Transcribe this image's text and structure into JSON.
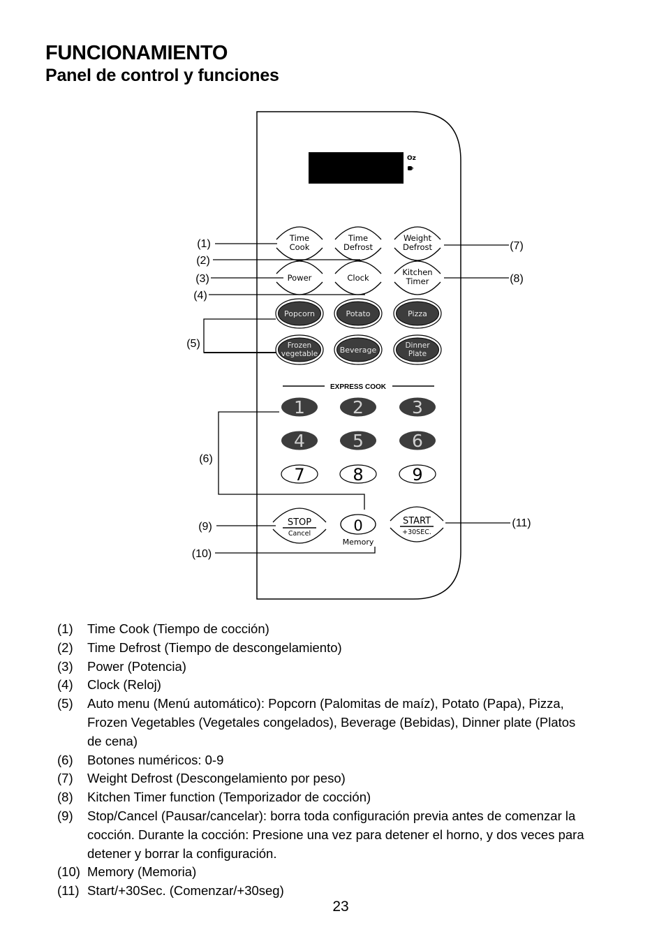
{
  "header": {
    "title": "FUNCIONAMIENTO",
    "subtitle": "Panel de control y funciones"
  },
  "panel": {
    "display": {
      "indicator_oz": "Oz",
      "indicator_cup_icon": "cup-icon"
    },
    "function_buttons": [
      {
        "id": "time-cook",
        "lines": [
          "Time",
          "Cook"
        ]
      },
      {
        "id": "time-defrost",
        "lines": [
          "Time",
          "Defrost"
        ]
      },
      {
        "id": "weight-defrost",
        "lines": [
          "Weight",
          "Defrost"
        ]
      },
      {
        "id": "power",
        "lines": [
          "Power"
        ]
      },
      {
        "id": "clock",
        "lines": [
          "Clock"
        ]
      },
      {
        "id": "kitchen-timer",
        "lines": [
          "Kitchen",
          "Timer"
        ]
      }
    ],
    "auto_menu_buttons": [
      {
        "id": "popcorn",
        "lines": [
          "Popcorn"
        ]
      },
      {
        "id": "potato",
        "lines": [
          "Potato"
        ]
      },
      {
        "id": "pizza",
        "lines": [
          "Pizza"
        ]
      },
      {
        "id": "frozen-vegetable",
        "lines": [
          "Frozen",
          "vegetable"
        ]
      },
      {
        "id": "beverage",
        "lines": [
          "Beverage"
        ]
      },
      {
        "id": "dinner-plate",
        "lines": [
          "Dinner",
          "Plate"
        ]
      }
    ],
    "express_cook_label": "EXPRESS COOK",
    "number_buttons_dark": [
      "1",
      "2",
      "3",
      "4",
      "5",
      "6"
    ],
    "number_buttons_light": [
      "7",
      "8",
      "9"
    ],
    "stop_button": {
      "main": "STOP",
      "sub": "Cancel"
    },
    "zero_button": {
      "main": "0",
      "sub": "Memory"
    },
    "start_button": {
      "main": "START",
      "sub": "+30SEC."
    },
    "colors": {
      "dark_button": "#3d3d3d",
      "dark_button_text": "#d0d0d0",
      "display": "#000000"
    }
  },
  "callouts": [
    "(1)",
    "(2)",
    "(3)",
    "(4)",
    "(5)",
    "(6)",
    "(7)",
    "(8)",
    "(9)",
    "(10)",
    "(11)"
  ],
  "legend": [
    {
      "num": "(1)",
      "text": "Time Cook (Tiempo de cocción)"
    },
    {
      "num": "(2)",
      "text": "Time Defrost (Tiempo de descongelamiento)"
    },
    {
      "num": "(3)",
      "text": "Power (Potencia)"
    },
    {
      "num": "(4)",
      "text": "Clock (Reloj)"
    },
    {
      "num": "(5)",
      "text": "Auto menu (Menú automático): Popcorn (Palomitas de maíz), Potato (Papa), Pizza, Frozen Vegetables (Vegetales congelados), Beverage (Bebidas), Dinner plate (Platos de cena)"
    },
    {
      "num": "(6)",
      "text": "Botones numéricos: 0-9"
    },
    {
      "num": "(7)",
      "text": "Weight Defrost (Descongelamiento por peso)"
    },
    {
      "num": "(8)",
      "text": "Kitchen Timer function (Temporizador de cocción)"
    },
    {
      "num": "(9)",
      "text": "Stop/Cancel (Pausar/cancelar): borra toda configuración previa antes de comenzar la cocción. Durante la cocción: Presione una vez para detener el horno, y dos veces para detener y borrar la configuración."
    },
    {
      "num": "(10)",
      "text": "Memory (Memoria)"
    },
    {
      "num": "(11)",
      "text": "Start/+30Sec. (Comenzar/+30seg)"
    }
  ],
  "page_number": "23"
}
